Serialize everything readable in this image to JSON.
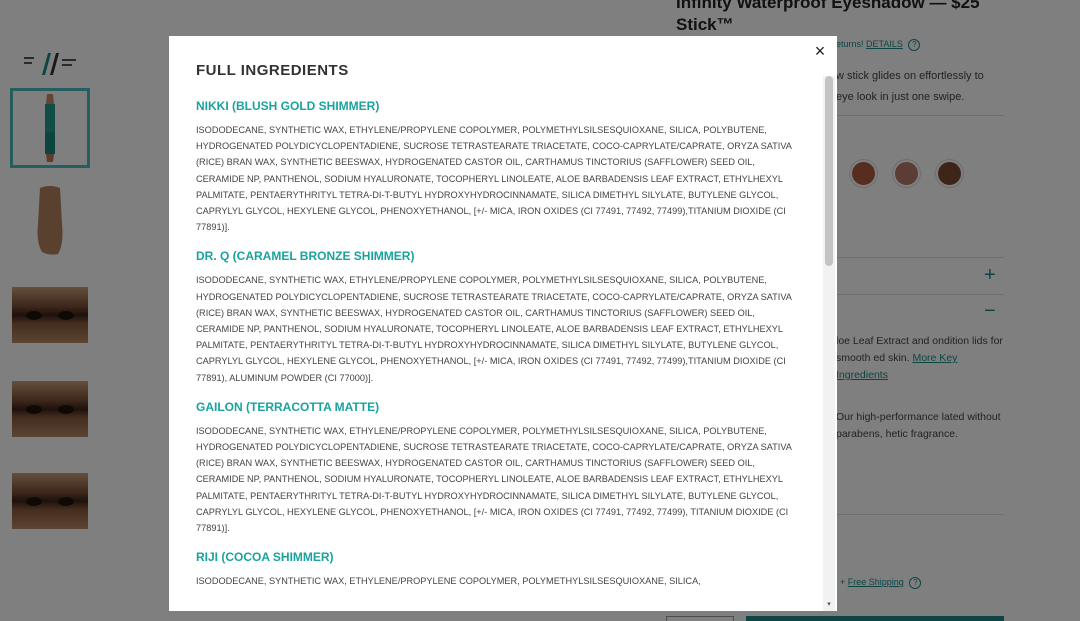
{
  "background": {
    "product_title": "Infinity Waterproof Eyeshadow — $25",
    "product_subtitle": "Stick™",
    "returns_text": "eturns!",
    "returns_link": "DETAILS",
    "description": "w stick glides on effortlessly to eye look in just one swipe.",
    "shade_colors": [
      "#b05a43",
      "#b77a6a",
      "#7b4a33"
    ],
    "ingredients_para": "loe Leaf Extract and ondition lids for smooth ed skin.",
    "ingredients_link": "More Key Ingredients",
    "clean_para": "Our high-performance lated without parabens, hetic fragrance.",
    "shipping_prefix": "+",
    "shipping_link": "Free Shipping",
    "plus_label": "+",
    "minus_label": "−",
    "help_symbol": "?"
  },
  "modal": {
    "title": "FULL INGREDIENTS",
    "close_label": "×",
    "scroll_down": "▾",
    "sections": [
      {
        "name": "NIKKI (BLUSH GOLD SHIMMER)",
        "ingredients": "ISODODECANE, SYNTHETIC WAX, ETHYLENE/PROPYLENE COPOLYMER, POLYMETHYLSILSESQUIOXANE, SILICA, POLYBUTENE, HYDROGENATED POLYDICYCLOPENTADIENE, SUCROSE TETRASTEARATE TRIACETATE, COCO-CAPRYLATE/CAPRATE, ORYZA SATIVA (RICE) BRAN WAX, SYNTHETIC BEESWAX, HYDROGENATED CASTOR OIL, CARTHAMUS TINCTORIUS (SAFFLOWER) SEED OIL, CERAMIDE NP, PANTHENOL, SODIUM HYALURONATE, TOCOPHERYL LINOLEATE, ALOE BARBADENSIS LEAF EXTRACT, ETHYLHEXYL PALMITATE, PENTAERYTHRITYL TETRA-DI-T-BUTYL HYDROXYHYDROCINNAMATE, SILICA DIMETHYL SILYLATE, BUTYLENE GLYCOL, CAPRYLYL GLYCOL, HEXYLENE GLYCOL, PHENOXYETHANOL, [+/- MICA, IRON OXIDES (CI 77491, 77492, 77499),TITANIUM DIOXIDE (CI 77891)]."
      },
      {
        "name": "DR. Q (CARAMEL BRONZE SHIMMER)",
        "ingredients": "ISODODECANE, SYNTHETIC WAX, ETHYLENE/PROPYLENE COPOLYMER, POLYMETHYLSILSESQUIOXANE, SILICA, POLYBUTENE, HYDROGENATED POLYDICYCLOPENTADIENE, SUCROSE TETRASTEARATE TRIACETATE, COCO-CAPRYLATE/CAPRATE, ORYZA SATIVA (RICE) BRAN WAX, SYNTHETIC BEESWAX, HYDROGENATED CASTOR OIL, CARTHAMUS TINCTORIUS (SAFFLOWER) SEED OIL, CERAMIDE NP, PANTHENOL, SODIUM HYALURONATE, TOCOPHERYL LINOLEATE, ALOE BARBADENSIS LEAF EXTRACT, ETHYLHEXYL PALMITATE, PENTAERYTHRITYL TETRA-DI-T-BUTYL HYDROXYHYDROCINNAMATE, SILICA DIMETHYL SILYLATE, BUTYLENE GLYCOL, CAPRYLYL GLYCOL, HEXYLENE GLYCOL, PHENOXYETHANOL, [+/- MICA, IRON OXIDES (CI 77491, 77492, 77499),TITANIUM DIOXIDE (CI 77891), ALUMINUM POWDER (CI 77000)]."
      },
      {
        "name": "GAILON (TERRACOTTA MATTE)",
        "ingredients": "ISODODECANE, SYNTHETIC WAX, ETHYLENE/PROPYLENE COPOLYMER, POLYMETHYLSILSESQUIOXANE, SILICA, POLYBUTENE, HYDROGENATED POLYDICYCLOPENTADIENE, SUCROSE TETRASTEARATE TRIACETATE, COCO-CAPRYLATE/CAPRATE, ORYZA SATIVA (RICE) BRAN WAX, SYNTHETIC BEESWAX, HYDROGENATED CASTOR OIL, CARTHAMUS TINCTORIUS (SAFFLOWER) SEED OIL, CERAMIDE NP, PANTHENOL, SODIUM HYALURONATE, TOCOPHERYL LINOLEATE, ALOE BARBADENSIS LEAF EXTRACT, ETHYLHEXYL PALMITATE, PENTAERYTHRITYL TETRA-DI-T-BUTYL HYDROXYHYDROCINNAMATE, SILICA DIMETHYL SILYLATE, BUTYLENE GLYCOL, CAPRYLYL GLYCOL, HEXYLENE GLYCOL, PHENOXYETHANOL, [+/- MICA, IRON OXIDES (CI 77491, 77492, 77499), TITANIUM DIOXIDE (CI 77891)]."
      },
      {
        "name": "RIJI (COCOA SHIMMER)",
        "ingredients": "ISODODECANE, SYNTHETIC WAX, ETHYLENE/PROPYLENE COPOLYMER, POLYMETHYLSILSESQUIOXANE, SILICA,"
      }
    ]
  }
}
